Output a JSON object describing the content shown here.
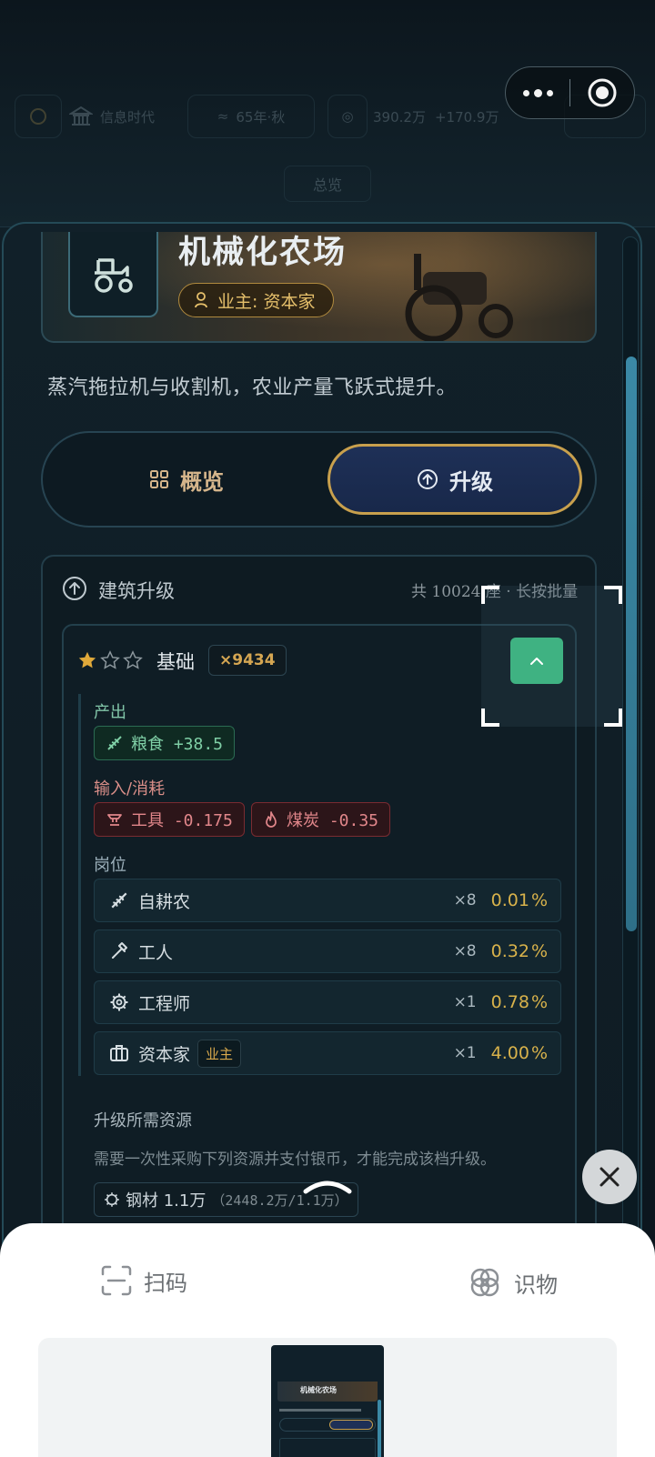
{
  "background": {
    "era": "信息时代",
    "date": "65年·秋",
    "money": "390.2万",
    "money_rate": "+170.9万",
    "tab": "总览"
  },
  "building": {
    "title": "机械化农场",
    "owner_label": "业主: 资本家",
    "description": "蒸汽拖拉机与收割机，农业产量飞跃式提升。"
  },
  "tabs": {
    "overview": "概览",
    "upgrade": "升级"
  },
  "upgrade_section": {
    "title": "建筑升级",
    "meta": "共 10024 座 · 长按批量"
  },
  "tier": {
    "stars_filled": 1,
    "stars_total": 3,
    "name": "基础",
    "count": "×9434",
    "output_label": "产出",
    "outputs": [
      {
        "icon": "wheat-icon",
        "text": "粮食 +38.5"
      }
    ],
    "input_label": "输入/消耗",
    "inputs": [
      {
        "icon": "anvil-icon",
        "text": "工具 -0.175"
      },
      {
        "icon": "flame-icon",
        "text": "煤炭 -0.35"
      }
    ],
    "jobs_label": "岗位",
    "jobs": [
      {
        "icon": "wheat-icon",
        "name": "自耕农",
        "owner": "",
        "count": "×8",
        "wage": "0.01"
      },
      {
        "icon": "hammer-icon",
        "name": "工人",
        "owner": "",
        "count": "×8",
        "wage": "0.32"
      },
      {
        "icon": "gear-icon",
        "name": "工程师",
        "owner": "",
        "count": "×1",
        "wage": "0.78"
      },
      {
        "icon": "briefcase-icon",
        "name": "资本家",
        "owner": "业主",
        "count": "×1",
        "wage": "4.00"
      }
    ],
    "requirements_title": "升级所需资源",
    "requirements_desc": "需要一次性采购下列资源并支付银币，才能完成该档升级。",
    "resources": [
      {
        "icon": "gear-icon",
        "name": "钢材 1.1万",
        "progress": "（2448.2万/1.1万）"
      }
    ]
  },
  "sheet": {
    "scan_label": "扫码",
    "identify_label": "识物"
  },
  "thumbnail": {
    "title": "机械化农场"
  },
  "colors": {
    "accent_gold": "#c8a04d",
    "positive_green": "#7fcfa6",
    "negative_red": "#e1868a",
    "button_green": "#3fb282",
    "wage_gold": "#d8b24b"
  }
}
